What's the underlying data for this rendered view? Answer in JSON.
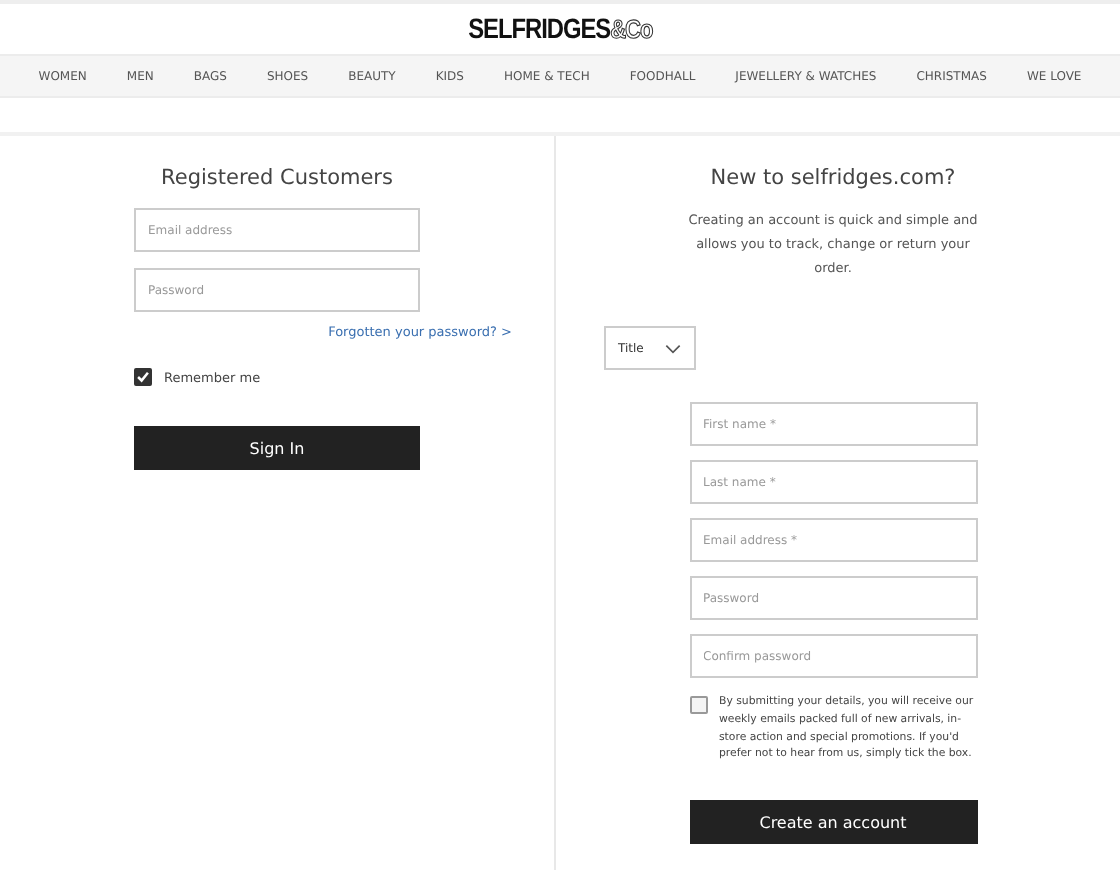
{
  "logo": {
    "main": "SELFRIDGES",
    "suffix": "&Co"
  },
  "nav": [
    {
      "label": "WOMEN"
    },
    {
      "label": "MEN"
    },
    {
      "label": "BAGS"
    },
    {
      "label": "SHOES"
    },
    {
      "label": "BEAUTY"
    },
    {
      "label": "KIDS"
    },
    {
      "label": "HOME & TECH"
    },
    {
      "label": "FOODHALL"
    },
    {
      "label": "JEWELLERY & WATCHES"
    },
    {
      "label": "CHRISTMAS"
    },
    {
      "label": "WE LOVE"
    }
  ],
  "sign_in": {
    "title": "Registered Customers",
    "fields": [
      {
        "placeholder": "Email address"
      },
      {
        "placeholder": "Password"
      }
    ],
    "forgot_link": "Forgotten your password? >",
    "remember": {
      "label": "Remember me",
      "checked": true
    },
    "button": "Sign In"
  },
  "register": {
    "title": "New to selfridges.com?",
    "intro": "Creating an account is quick and simple and allows you to track, change or return your order.",
    "title_select": "Title",
    "fields": [
      {
        "placeholder": "First name *"
      },
      {
        "placeholder": "Last name *"
      },
      {
        "placeholder": "Email address *"
      },
      {
        "placeholder": "Password"
      },
      {
        "placeholder": "Confirm password"
      }
    ],
    "opt_out": {
      "label": "By submitting your details, you will receive our weekly emails packed full of new arrivals, in-store action and special promotions. If you'd prefer not to hear from us, simply tick the box.",
      "checked": false
    },
    "button": "Create an account"
  }
}
